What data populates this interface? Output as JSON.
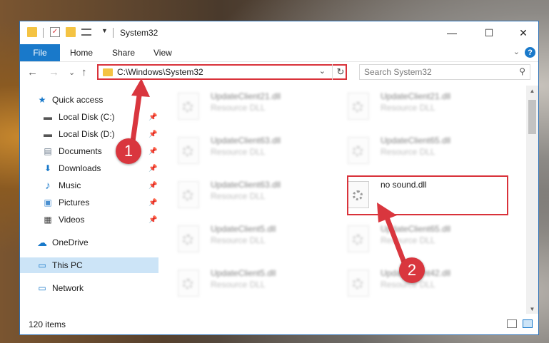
{
  "window": {
    "title": "System32",
    "controls": {
      "minimize": "—",
      "maximize": "☐",
      "close": "✕"
    }
  },
  "ribbon": {
    "file_tab": "File",
    "tabs": [
      "Home",
      "Share",
      "View"
    ],
    "expand_glyph": "⌄",
    "help_glyph": "?"
  },
  "navigation": {
    "back_glyph": "←",
    "forward_glyph": "→",
    "recent_glyph": "⌄",
    "up_glyph": "↑",
    "address_path": "C:\\Windows\\System32",
    "address_dropdown_glyph": "⌄",
    "refresh_glyph": "↻",
    "search_placeholder": "Search System32",
    "search_glyph": "⚲"
  },
  "nav_pane": {
    "items": [
      {
        "label": "Quick access",
        "icon": "star-icon",
        "glyph": "★",
        "color": "#1979ca",
        "pinned": false
      },
      {
        "label": "Local Disk (C:)",
        "icon": "drive-icon",
        "glyph": "▬",
        "color": "#555555",
        "pinned": true
      },
      {
        "label": "Local Disk (D:)",
        "icon": "drive-icon",
        "glyph": "▬",
        "color": "#555555",
        "pinned": true
      },
      {
        "label": "Documents",
        "icon": "documents-icon",
        "glyph": "▤",
        "color": "#6a7a8a",
        "pinned": true
      },
      {
        "label": "Downloads",
        "icon": "download-icon",
        "glyph": "⬇",
        "color": "#1979ca",
        "pinned": true
      },
      {
        "label": "Music",
        "icon": "music-icon",
        "glyph": "♪",
        "color": "#1979ca",
        "pinned": true
      },
      {
        "label": "Pictures",
        "icon": "pictures-icon",
        "glyph": "▣",
        "color": "#4a8fd0",
        "pinned": true
      },
      {
        "label": "Videos",
        "icon": "videos-icon",
        "glyph": "▦",
        "color": "#444444",
        "pinned": true
      },
      {
        "label": "OneDrive",
        "icon": "cloud-icon",
        "glyph": "☁",
        "color": "#1979ca",
        "pinned": false
      },
      {
        "label": "This PC",
        "icon": "computer-icon",
        "glyph": "▭",
        "color": "#1979ca",
        "pinned": false,
        "selected": true
      },
      {
        "label": "Network",
        "icon": "network-icon",
        "glyph": "▭",
        "color": "#1979ca",
        "pinned": false
      }
    ],
    "pin_glyph": "📌"
  },
  "files": [
    {
      "name": "UpdateClient21.dll",
      "type": "Resource DLL",
      "blurred": true
    },
    {
      "name": "UpdateClient21.dll",
      "type": "Resource DLL",
      "blurred": true
    },
    {
      "name": "UpdateClient63.dll",
      "type": "Resource DLL",
      "blurred": true
    },
    {
      "name": "UpdateClient65.dll",
      "type": "Resource DLL",
      "blurred": true
    },
    {
      "name": "UpdateClient63.dll",
      "type": "Resource DLL",
      "blurred": true
    },
    {
      "name": "no sound.dll",
      "type": "",
      "blurred": false
    },
    {
      "name": "UpdateClient5.dll",
      "type": "Resource DLL",
      "blurred": true
    },
    {
      "name": "UpdateClient65.dll",
      "type": "Resource DLL",
      "blurred": true
    },
    {
      "name": "UpdateClient5.dll",
      "type": "Resource DLL",
      "blurred": true
    },
    {
      "name": "UpdateClient42.dll",
      "type": "Resource DLL",
      "blurred": true
    }
  ],
  "status": {
    "item_count": "120 items"
  },
  "annotations": {
    "callout_1": "1",
    "callout_2": "2",
    "accent_color": "#d9363e"
  }
}
